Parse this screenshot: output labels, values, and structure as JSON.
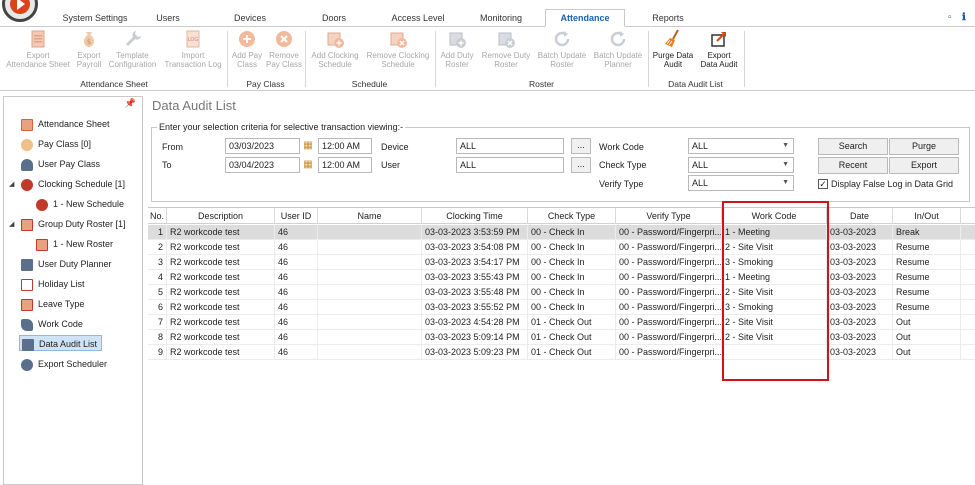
{
  "tabs": [
    {
      "label": "System Settings",
      "active": false
    },
    {
      "label": "Users",
      "active": false
    },
    {
      "label": "Devices",
      "active": false
    },
    {
      "label": "Doors",
      "active": false
    },
    {
      "label": "Access Level",
      "active": false
    },
    {
      "label": "Monitoring",
      "active": false
    },
    {
      "label": "Attendance",
      "active": true
    },
    {
      "label": "Reports",
      "active": false
    }
  ],
  "ribbon": {
    "buttons": [
      {
        "label": "Export\nAttendance Sheet",
        "enabled": false,
        "icon": "export-doc-icon"
      },
      {
        "label": "Export\nPayroll",
        "enabled": false,
        "icon": "money-bag-icon"
      },
      {
        "label": "Template\nConfiguration",
        "enabled": false,
        "icon": "wrench-icon"
      },
      {
        "label": "Import\nTransaction Log",
        "enabled": false,
        "icon": "log-icon"
      },
      {
        "label": "Add Pay\nClass",
        "enabled": false,
        "icon": "add-circle-icon"
      },
      {
        "label": "Remove\nPay Class",
        "enabled": false,
        "icon": "remove-circle-icon"
      },
      {
        "label": "Add Clocking\nSchedule",
        "enabled": false,
        "icon": "add-schedule-icon"
      },
      {
        "label": "Remove Clocking\nSchedule",
        "enabled": false,
        "icon": "remove-schedule-icon"
      },
      {
        "label": "Add Duty\nRoster",
        "enabled": false,
        "icon": "add-roster-icon"
      },
      {
        "label": "Remove Duty\nRoster",
        "enabled": false,
        "icon": "remove-roster-icon"
      },
      {
        "label": "Batch Update\nRoster",
        "enabled": false,
        "icon": "refresh-icon"
      },
      {
        "label": "Batch Update\nPlanner",
        "enabled": false,
        "icon": "refresh-icon"
      },
      {
        "label": "Purge Data\nAudit",
        "enabled": true,
        "icon": "broom-icon"
      },
      {
        "label": "Export\nData Audit",
        "enabled": true,
        "icon": "export-arrow-icon"
      }
    ],
    "groups": [
      "Attendance Sheet",
      "Pay Class",
      "Schedule",
      "Roster",
      "Data Audit List"
    ]
  },
  "sidebar": {
    "pin_icon": "pin-icon",
    "items": [
      {
        "label": "Attendance Sheet",
        "icon": "attendance-sheet-icon",
        "color": "#d9623a"
      },
      {
        "label": "Pay Class [0]",
        "icon": "pay-class-icon",
        "color": "#d98a2a"
      },
      {
        "label": "User Pay Class",
        "icon": "user-icon",
        "color": "#5a6f8c"
      },
      {
        "label": "Clocking Schedule [1]",
        "icon": "clock-icon",
        "color": "#c0392b"
      },
      {
        "label": "1 - New Schedule",
        "icon": "clock-icon",
        "color": "#c0392b"
      },
      {
        "label": "Group Duty Roster [1]",
        "icon": "roster-icon",
        "color": "#c0392b"
      },
      {
        "label": "1 - New Roster",
        "icon": "roster-icon",
        "color": "#c0392b"
      },
      {
        "label": "User Duty Planner",
        "icon": "planner-icon",
        "color": "#5a6f8c"
      },
      {
        "label": "Holiday List",
        "icon": "holiday-icon",
        "color": "#c0392b"
      },
      {
        "label": "Leave Type",
        "icon": "leave-icon",
        "color": "#c0392b"
      },
      {
        "label": "Work Code",
        "icon": "work-code-icon",
        "color": "#5a6f8c"
      },
      {
        "label": "Data Audit List",
        "icon": "data-audit-icon",
        "color": "#5a6f8c"
      },
      {
        "label": "Export Scheduler",
        "icon": "export-scheduler-icon",
        "color": "#5a6f8c"
      }
    ]
  },
  "page": {
    "title": "Data Audit List",
    "criteria_legend": "Enter your selection criteria for selective transaction viewing:-"
  },
  "criteria": {
    "from_label": "From",
    "to_label": "To",
    "from_date": "03/03/2023",
    "to_date": "03/04/2023",
    "from_time": "12:00 AM",
    "to_time": "12:00 AM",
    "device_label": "Device",
    "device_value": "ALL",
    "user_label": "User",
    "user_value": "ALL",
    "browse_label": "...",
    "work_code_label": "Work Code",
    "work_code_value": "ALL",
    "check_type_label": "Check Type",
    "check_type_value": "ALL",
    "verify_type_label": "Verify Type",
    "verify_type_value": "ALL",
    "search_label": "Search",
    "purge_label": "Purge",
    "recent_label": "Recent",
    "export_label": "Export",
    "false_log_label": "Display False Log in Data Grid",
    "false_log_checked": true
  },
  "grid": {
    "columns": [
      "No.",
      "Description",
      "User ID",
      "Name",
      "Clocking Time",
      "Check Type",
      "Verify Type",
      "Work Code",
      "Date",
      "In/Out"
    ],
    "rows": [
      [
        "1",
        "R2  workcode test",
        "46",
        "",
        "03-03-2023 3:53:59 PM",
        "00 - Check In",
        "00 - Password/Fingerpri...",
        "1 - Meeting",
        "03-03-2023",
        "Break"
      ],
      [
        "2",
        "R2  workcode test",
        "46",
        "",
        "03-03-2023 3:54:08 PM",
        "00 - Check In",
        "00 - Password/Fingerpri...",
        "2 - Site Visit",
        "03-03-2023",
        "Resume"
      ],
      [
        "3",
        "R2  workcode test",
        "46",
        "",
        "03-03-2023 3:54:17 PM",
        "00 - Check In",
        "00 - Password/Fingerpri...",
        "3 - Smoking",
        "03-03-2023",
        "Resume"
      ],
      [
        "4",
        "R2  workcode test",
        "46",
        "",
        "03-03-2023 3:55:43 PM",
        "00 - Check In",
        "00 - Password/Fingerpri...",
        "1 - Meeting",
        "03-03-2023",
        "Resume"
      ],
      [
        "5",
        "R2  workcode test",
        "46",
        "",
        "03-03-2023 3:55:48 PM",
        "00 - Check In",
        "00 - Password/Fingerpri...",
        "2 - Site Visit",
        "03-03-2023",
        "Resume"
      ],
      [
        "6",
        "R2  workcode test",
        "46",
        "",
        "03-03-2023 3:55:52 PM",
        "00 - Check In",
        "00 - Password/Fingerpri...",
        "3 - Smoking",
        "03-03-2023",
        "Resume"
      ],
      [
        "7",
        "R2  workcode test",
        "46",
        "",
        "03-03-2023 4:54:28 PM",
        "01 - Check Out",
        "00 - Password/Fingerpri...",
        "2 - Site Visit",
        "03-03-2023",
        "Out"
      ],
      [
        "8",
        "R2  workcode test",
        "46",
        "",
        "03-03-2023 5:09:14 PM",
        "01 - Check Out",
        "00 - Password/Fingerpri...",
        "2 - Site Visit",
        "03-03-2023",
        "Out"
      ],
      [
        "9",
        "R2  workcode test",
        "46",
        "",
        "03-03-2023 5:09:23 PM",
        "01 - Check Out",
        "00 - Password/Fingerpri...",
        "",
        "03-03-2023",
        "Out"
      ]
    ],
    "selected_row": 0,
    "highlight_color": "#d0121b"
  }
}
